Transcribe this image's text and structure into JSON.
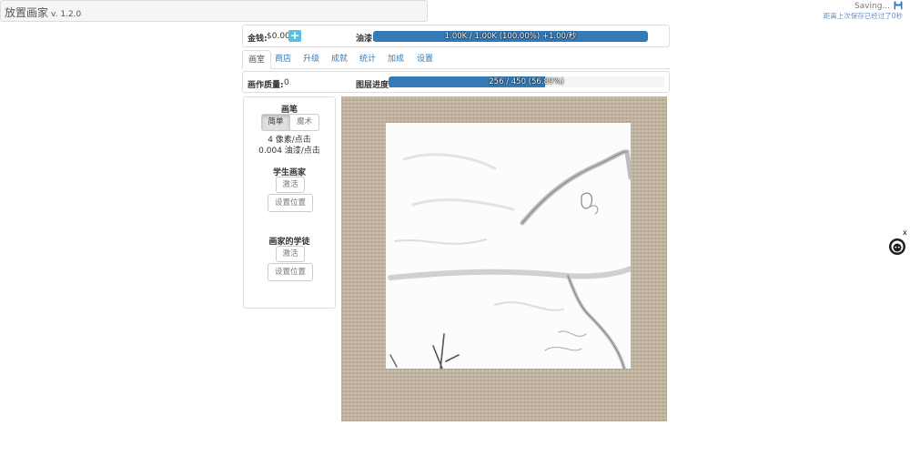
{
  "header": {
    "title": "放置画家",
    "version": "v. 1.2.0",
    "saving": "Saving...",
    "save_info": "距离上次保存已经过了0秒"
  },
  "resources": {
    "money_label": "金钱:",
    "money_value": "$0.00",
    "plus_label": "+",
    "oil_label": "油漆:",
    "oil_text": "1.00K / 1.00K (100.00%) +1.00/秒",
    "oil_fraction": 1.0
  },
  "tabs": [
    {
      "label": "画室",
      "active": true
    },
    {
      "label": "商店"
    },
    {
      "label": "升级"
    },
    {
      "label": "成就"
    },
    {
      "label": "统计"
    },
    {
      "label": "加成"
    },
    {
      "label": "设置"
    }
  ],
  "quality": {
    "label": "画作质量:",
    "value": "0",
    "layer_label": "图层进度:",
    "layer_text": "256 / 450 (56.89%)",
    "layer_fraction": 0.5689
  },
  "tools": {
    "brush_title": "画笔",
    "mode_simple": "简单",
    "mode_magic": "魔术",
    "pixels_per_click": "4 像素/点击",
    "oil_per_click": "0.004 油漆/点击",
    "student_title": "学生画家",
    "student_activate": "激活",
    "student_set_position": "设置位置",
    "apprentice_title": "画家的学徒",
    "apprentice_activate": "激活",
    "apprentice_set_position": "设置位置"
  },
  "colors": {
    "accent": "#337ab7",
    "info_button": "#5bc0de",
    "canvas_linen": "#c2b6a2"
  },
  "side": {
    "close": "x",
    "icon": "octocat-icon"
  }
}
